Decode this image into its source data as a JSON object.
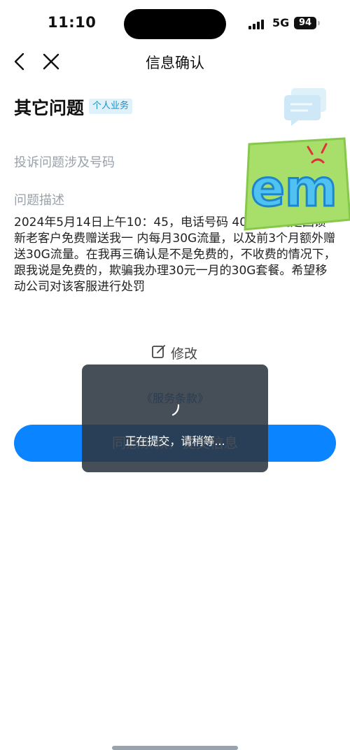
{
  "status_bar": {
    "time": "11:10",
    "network": "5G",
    "battery": "94"
  },
  "navbar": {
    "back_icon": "chevron-left-icon",
    "close_icon": "close-icon",
    "title": "信息确认"
  },
  "issue": {
    "title": "其它问题",
    "badge": "个人业务"
  },
  "form": {
    "phone_label": "投诉问题涉及号码",
    "description_label": "问题描述",
    "description_text": "2024年5月14日上午10：45，电话号码 404来电说是回馈新老客户免费赠送我一 内每月30G流量，以及前3个月额外赠送30G流量。在我再三确认是不是免费的，不收费的情况下，跟我说是免费的，欺骗我办理30元一月的30G套餐。希望移动公司对该客服进行处罚"
  },
  "sticker": {
    "text": "em"
  },
  "actions": {
    "edit_label": "修改",
    "terms_link": "《服务条款》",
    "submit_label": "同意条款，提交信息"
  },
  "toast": {
    "message": "正在提交，请稍等..."
  },
  "colors": {
    "accent": "#0a84ff",
    "link": "#1a75d1",
    "badge_bg": "#dff2fb",
    "badge_text": "#1a8fc7"
  }
}
